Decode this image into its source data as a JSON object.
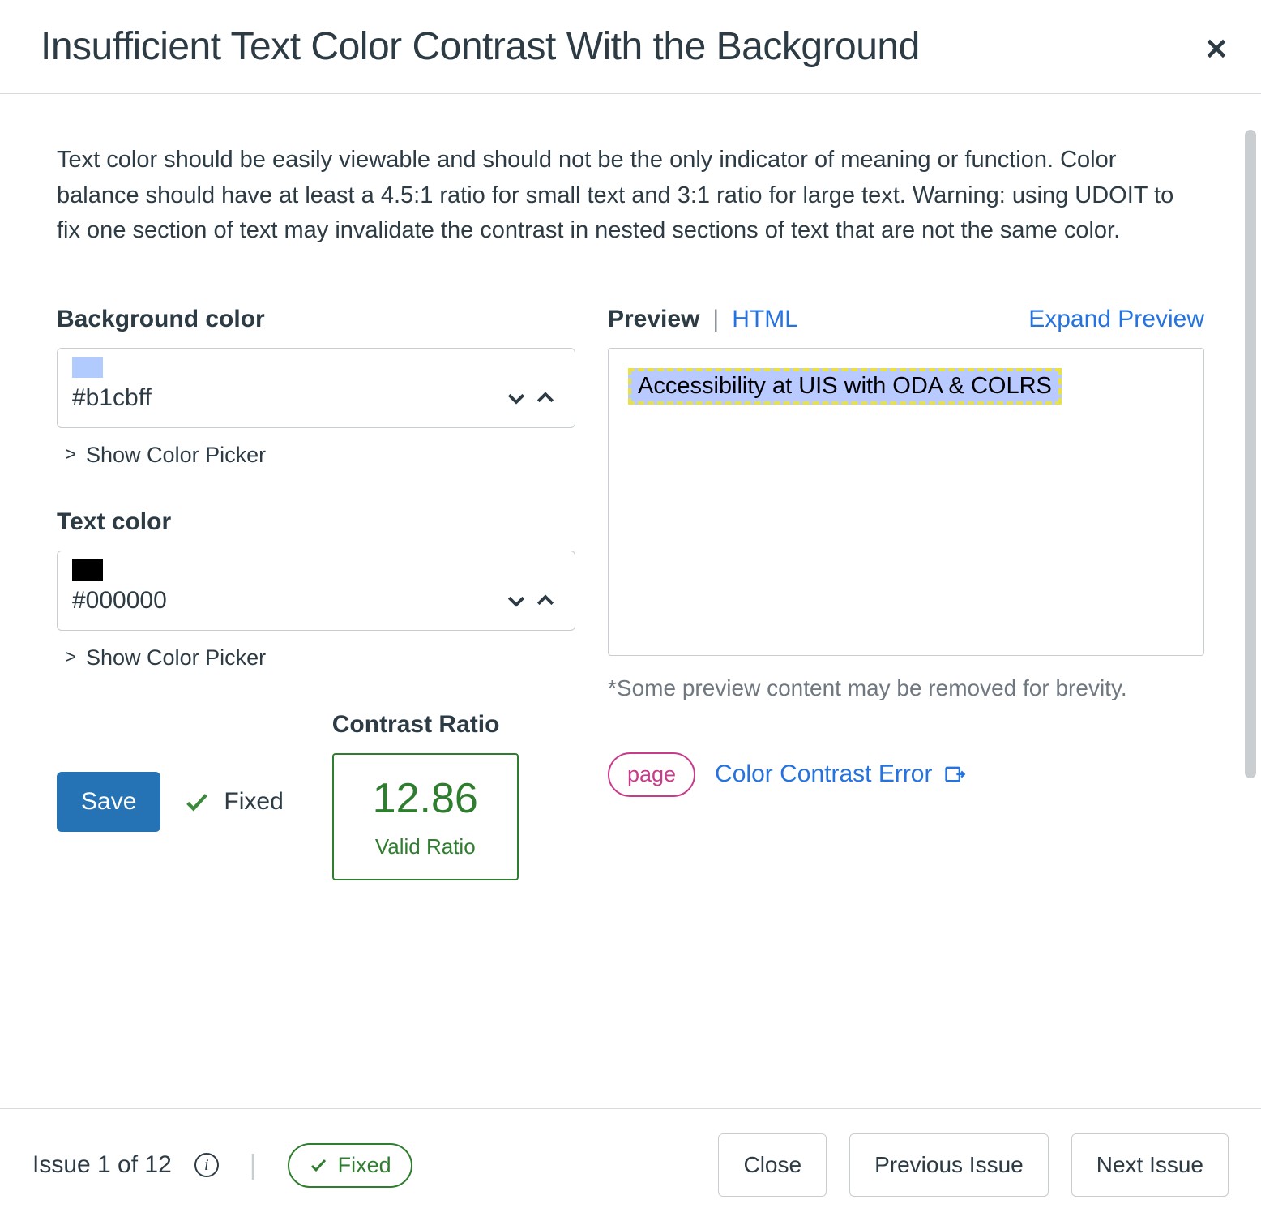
{
  "header": {
    "title": "Insufficient Text Color Contrast With the Background"
  },
  "description": "Text color should be easily viewable and should not be the only indicator of meaning or function. Color balance should have at least a 4.5:1 ratio for small text and 3:1 ratio for large text. Warning: using UDOIT to fix one section of text may invalidate the contrast in nested sections of text that are not the same color.",
  "form": {
    "bg_label": "Background color",
    "bg_value": "#b1cbff",
    "bg_swatch": "#b1cbff",
    "text_label": "Text color",
    "text_value": "#000000",
    "text_swatch": "#000000",
    "show_picker": "Show Color Picker",
    "save": "Save",
    "fixed": "Fixed",
    "contrast_title": "Contrast Ratio",
    "ratio_value": "12.86",
    "ratio_label": "Valid Ratio"
  },
  "preview": {
    "tab_preview": "Preview",
    "tab_html": "HTML",
    "expand": "Expand Preview",
    "content": "Accessibility at UIS with ODA & COLRS",
    "note": "*Some preview content may be removed for brevity.",
    "badge": "page",
    "error_link": "Color Contrast Error"
  },
  "footer": {
    "issue_text": "Issue 1 of 12",
    "fixed": "Fixed",
    "close": "Close",
    "prev": "Previous Issue",
    "next": "Next Issue"
  }
}
